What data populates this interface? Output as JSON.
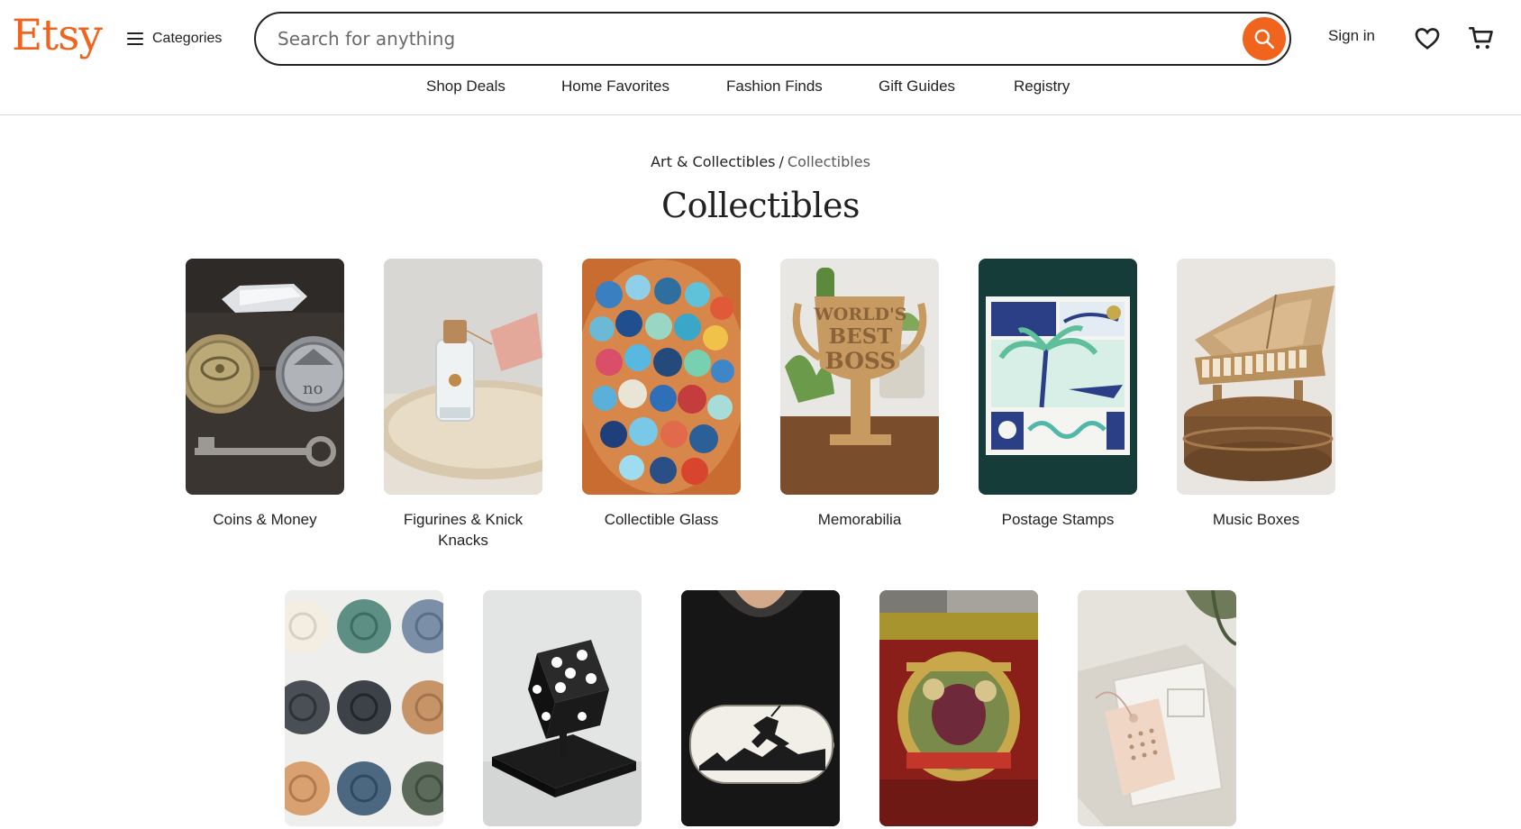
{
  "header": {
    "logo": "Etsy",
    "categories_label": "Categories",
    "search": {
      "placeholder": "Search for anything",
      "value": ""
    },
    "sign_in": "Sign in",
    "icons": [
      "menu-icon",
      "search-icon",
      "heart-icon",
      "cart-icon"
    ]
  },
  "subnav": [
    "Shop Deals",
    "Home Favorites",
    "Fashion Finds",
    "Gift Guides",
    "Registry"
  ],
  "breadcrumb": {
    "parent": "Art & Collectibles",
    "separator": "/",
    "current": "Collectibles"
  },
  "page_title": "Collectibles",
  "categories": [
    {
      "label": "Coins & Money"
    },
    {
      "label": "Figurines & Knick Knacks"
    },
    {
      "label": "Collectible Glass"
    },
    {
      "label": "Memorabilia"
    },
    {
      "label": "Postage Stamps"
    },
    {
      "label": "Music Boxes"
    }
  ],
  "categories_row2": [
    {
      "label": ""
    },
    {
      "label": ""
    },
    {
      "label": ""
    },
    {
      "label": ""
    },
    {
      "label": ""
    }
  ],
  "image_text": {
    "memorabilia_sign": [
      "WORLD'S",
      "BEST",
      "BOSS"
    ]
  },
  "colors": {
    "brand": "#f1641e",
    "text": "#222222",
    "border": "#d6d6d6"
  }
}
